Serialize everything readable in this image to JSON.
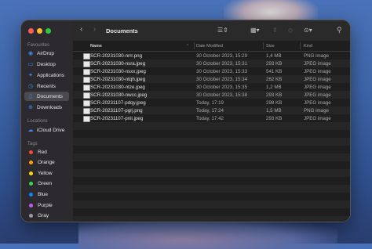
{
  "toolbar": {
    "title": "Documents",
    "icons": [
      "chevron-left-icon",
      "chevron-right-icon",
      "list-view-icon",
      "grid-view-icon",
      "share-icon",
      "tag-icon",
      "more-icon",
      "search-icon"
    ]
  },
  "sidebar": {
    "favourites_title": "Favourites",
    "favourites": [
      {
        "label": "AirDrop",
        "icon": "airdrop-icon"
      },
      {
        "label": "Desktop",
        "icon": "desktop-icon"
      },
      {
        "label": "Applications",
        "icon": "applications-icon"
      },
      {
        "label": "Recents",
        "icon": "clock-icon"
      },
      {
        "label": "Documents",
        "icon": "document-icon",
        "active": true
      },
      {
        "label": "Downloads",
        "icon": "download-icon"
      }
    ],
    "locations_title": "Locations",
    "locations": [
      {
        "label": "iCloud Drive",
        "icon": "cloud-icon"
      }
    ],
    "tags_title": "Tags",
    "tags": [
      {
        "label": "Red",
        "color": "#ff453a"
      },
      {
        "label": "Orange",
        "color": "#ff9f0a"
      },
      {
        "label": "Yellow",
        "color": "#ffd60a"
      },
      {
        "label": "Green",
        "color": "#32d74b"
      },
      {
        "label": "Blue",
        "color": "#0a84ff"
      },
      {
        "label": "Purple",
        "color": "#bf5af2"
      },
      {
        "label": "Gray",
        "color": "#98989d"
      }
    ]
  },
  "table": {
    "columns": {
      "name": "Name",
      "date": "Date Modified",
      "size": "Size",
      "kind": "Kind"
    },
    "rows": [
      {
        "name": "SCR-20231030-nrrr.png",
        "date": "30 October 2023, 15:29",
        "size": "1,4 MB",
        "kind": "PNG image"
      },
      {
        "name": "SCR-20231030-nsra.jpeg",
        "date": "30 October 2023, 15:31",
        "size": "293 KB",
        "kind": "JPEG image"
      },
      {
        "name": "SCR-20231030-nsxx.jpeg",
        "date": "30 October 2023, 15:33",
        "size": "541 KB",
        "kind": "JPEG image"
      },
      {
        "name": "SCR-20231030-ntqh.jpeg",
        "date": "30 October 2023, 15:34",
        "size": "262 KB",
        "kind": "JPEG image"
      },
      {
        "name": "SCR-20231030-ntze.jpeg",
        "date": "30 October 2023, 15:35",
        "size": "1,2 MB",
        "kind": "JPEG image"
      },
      {
        "name": "SCR-20231030-nwcc.jpeg",
        "date": "30 October 2023, 15:38",
        "size": "293 KB",
        "kind": "JPEG image"
      },
      {
        "name": "SCR-20231107-pdqy.jpeg",
        "date": "Today, 17:19",
        "size": "298 KB",
        "kind": "JPEG image"
      },
      {
        "name": "SCR-20231107-pgrj.png",
        "date": "Today, 17:24",
        "size": "1,5 MB",
        "kind": "PNG image"
      },
      {
        "name": "SCR-20231107-pnii.jpeg",
        "date": "Today, 17:42",
        "size": "293 KB",
        "kind": "JPEG image"
      }
    ]
  }
}
